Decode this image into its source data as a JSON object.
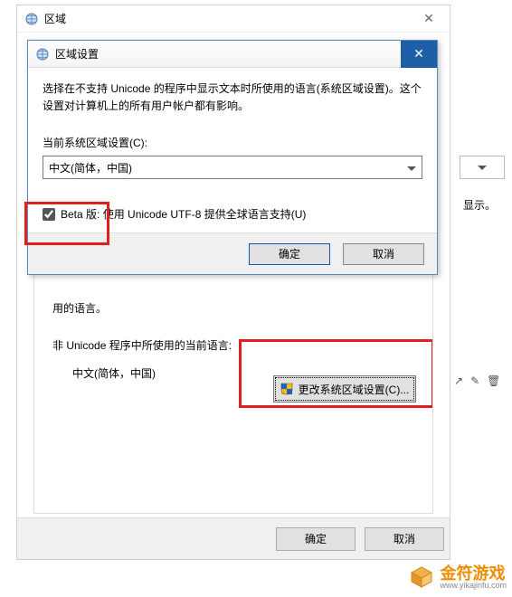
{
  "parent_window": {
    "title": "区域",
    "body": {
      "used_language_fragment": "用的语言。",
      "non_unicode_label": "非 Unicode 程序中所使用的当前语言:",
      "non_unicode_value": "中文(简体，中国)",
      "change_locale_label": "更改系统区域设置(C)..."
    },
    "buttons": {
      "ok": "确定",
      "cancel": "取消"
    }
  },
  "right_panel": {
    "show_fragment": "显示。"
  },
  "modal": {
    "title": "区域设置",
    "description": "选择在不支持 Unicode 的程序中显示文本时所使用的语言(系统区域设置)。这个设置对计算机上的所有用户帐户都有影响。",
    "locale_label": "当前系统区域设置(C):",
    "locale_value": "中文(简体，中国)",
    "beta_checkbox_label": "Beta 版: 使用 Unicode UTF-8 提供全球语言支持(U)",
    "beta_checked": true,
    "buttons": {
      "ok": "确定",
      "cancel": "取消"
    }
  },
  "watermark": {
    "name": "金符游戏",
    "domain": "www.yikajinfu.com"
  }
}
